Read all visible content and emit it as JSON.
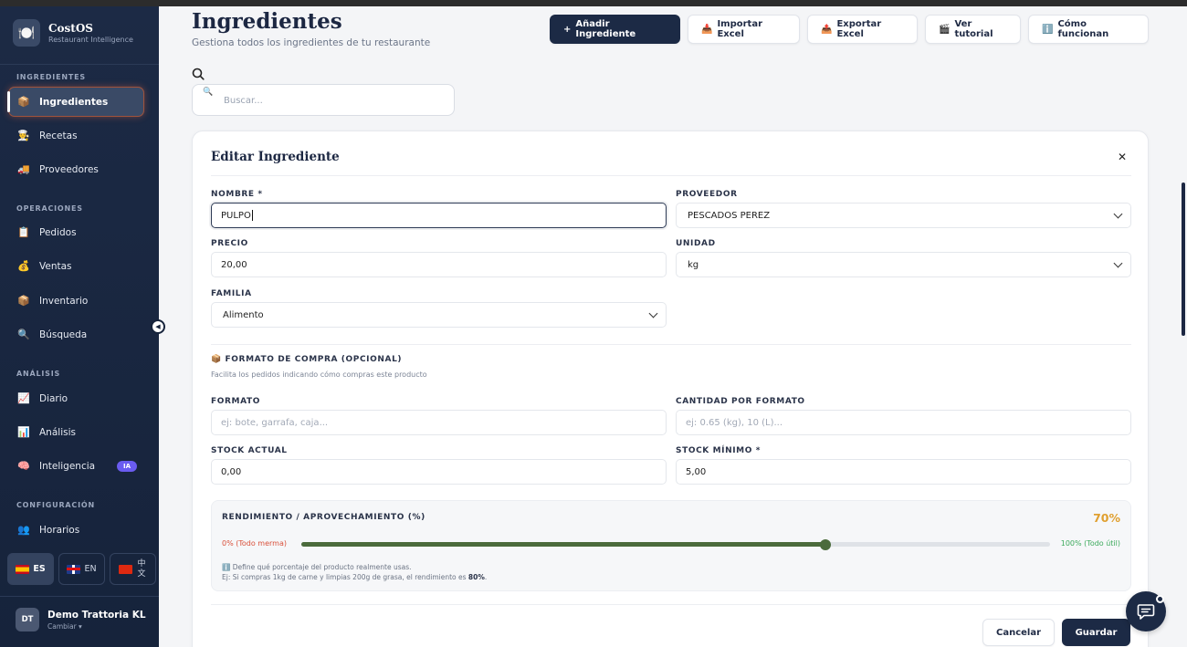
{
  "brand": {
    "name": "CostOS",
    "subtitle": "Restaurant Intelligence",
    "logo_icon": "🍽️"
  },
  "sidebar": {
    "sections": [
      {
        "title": "INGREDIENTES"
      },
      {
        "title": "OPERACIONES"
      },
      {
        "title": "ANÁLISIS"
      },
      {
        "title": "CONFIGURACIÓN"
      }
    ],
    "items": [
      {
        "label": "Ingredientes",
        "icon": "📦",
        "active": true
      },
      {
        "label": "Recetas",
        "icon": "👨‍🍳"
      },
      {
        "label": "Proveedores",
        "icon": "🚚"
      },
      {
        "label": "Pedidos",
        "icon": "📋"
      },
      {
        "label": "Ventas",
        "icon": "💰"
      },
      {
        "label": "Inventario",
        "icon": "📦"
      },
      {
        "label": "Búsqueda",
        "icon": "🔍"
      },
      {
        "label": "Diario",
        "icon": "📈"
      },
      {
        "label": "Análisis",
        "icon": "📊"
      },
      {
        "label": "Inteligencia",
        "icon": "🧠",
        "badge": "IA"
      },
      {
        "label": "Horarios",
        "icon": "👥"
      }
    ],
    "languages": [
      {
        "code": "ES",
        "active": true
      },
      {
        "code": "EN"
      },
      {
        "code": "中文"
      }
    ],
    "user": {
      "initials": "DT",
      "name": "Demo Trattoria KL",
      "sub": "Cambiar ▾"
    }
  },
  "header": {
    "title": "Ingredientes",
    "subtitle": "Gestiona todos los ingredientes de tu restaurante",
    "actions": [
      {
        "label": "Añadir Ingrediente",
        "icon": "+",
        "primary": true
      },
      {
        "label": "Importar Excel",
        "icon": "📥"
      },
      {
        "label": "Exportar Excel",
        "icon": "📤"
      },
      {
        "label": "Ver tutorial",
        "icon": "🎬"
      },
      {
        "label": "Cómo funcionan",
        "icon": "ℹ️"
      }
    ]
  },
  "search": {
    "placeholder": "Buscar..."
  },
  "form": {
    "title": "Editar Ingrediente",
    "fields": {
      "nombre": {
        "label": "NOMBRE *",
        "value": "PULPO"
      },
      "proveedor": {
        "label": "PROVEEDOR",
        "value": "PESCADOS PEREZ"
      },
      "precio": {
        "label": "PRECIO",
        "value": "20,00"
      },
      "unidad": {
        "label": "UNIDAD",
        "value": "kg"
      },
      "familia": {
        "label": "FAMILIA",
        "value": "Alimento"
      }
    },
    "purchase_format": {
      "heading": "📦 FORMATO DE COMPRA (OPCIONAL)",
      "hint": "Facilita los pedidos indicando cómo compras este producto",
      "formato": {
        "label": "FORMATO",
        "placeholder": "ej: bote, garrafa, caja..."
      },
      "cantidad": {
        "label": "CANTIDAD POR FORMATO",
        "placeholder": "ej: 0.65 (kg), 10 (L)..."
      },
      "stock_actual": {
        "label": "STOCK ACTUAL",
        "value": "0,00"
      },
      "stock_minimo": {
        "label": "STOCK MÍNIMO *",
        "value": "5,00"
      }
    },
    "yield": {
      "title": "RENDIMIENTO / APROVECHAMIENTO (%)",
      "display": "70%",
      "value_fraction": 0.7,
      "min_label": "0% (Todo merma)",
      "max_label": "100% (Todo útil)",
      "info_line1": "ℹ️ Define qué porcentaje del producto realmente usas.",
      "info_line2_prefix": "Ej: Si compras 1kg de carne y limpias 200g de grasa, el rendimiento es ",
      "info_line2_bold": "80%",
      "info_line2_suffix": "."
    },
    "cancel_label": "Cancelar",
    "save_label": "Guardar"
  },
  "colors": {
    "sidebar_bg": "#1c2a45",
    "primary": "#1c2a45",
    "yield_accent": "#e0a030",
    "slider": "#4b6b3c",
    "ia_badge": "#6a5cf0"
  }
}
